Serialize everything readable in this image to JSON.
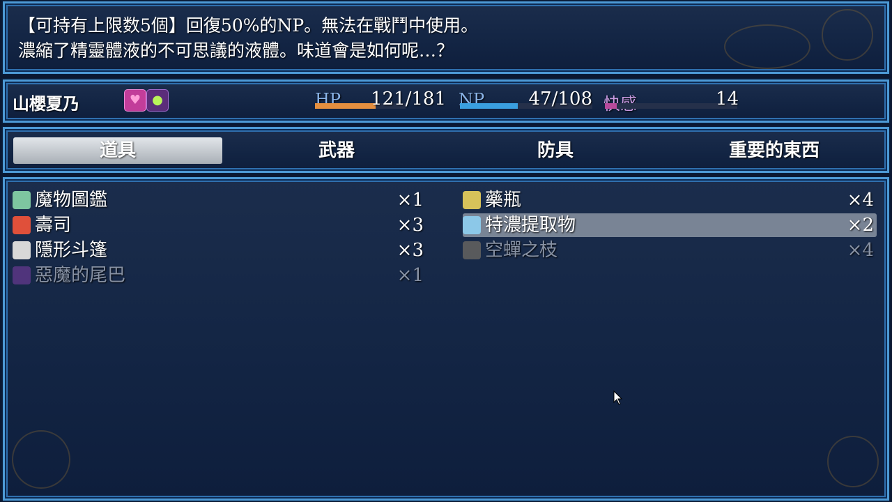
{
  "help": {
    "line1": "【可持有上限数5個】回復50%的NP。無法在戰鬥中使用。",
    "line2": "濃縮了精靈體液的不可思議的液體。味道會是如何呢…？"
  },
  "status": {
    "name": "山櫻夏乃",
    "hp": {
      "label": "HP",
      "value": "121/181",
      "ratio": 0.668,
      "color": "#e58f3f"
    },
    "np": {
      "label": "NP",
      "value": "47/108",
      "ratio": 0.435,
      "color": "#3a9fe0"
    },
    "pleasure": {
      "label": "快感",
      "value": "14",
      "ratio": 0.09,
      "color": "#b84a9c"
    },
    "state_icons": [
      "heart-state-icon",
      "slime-state-icon"
    ]
  },
  "tabs": [
    "道具",
    "武器",
    "防具",
    "重要的東西"
  ],
  "selected_tab": 0,
  "items": [
    {
      "name": "魔物圖鑑",
      "count": "×1",
      "icon": "book-icon",
      "icon_color": "#7ec6a0",
      "enabled": true
    },
    {
      "name": "藥瓶",
      "count": "×4",
      "icon": "vial-icon",
      "icon_color": "#d7c25a",
      "enabled": true
    },
    {
      "name": "壽司",
      "count": "×3",
      "icon": "sushi-icon",
      "icon_color": "#e0503a",
      "enabled": true
    },
    {
      "name": "特濃提取物",
      "count": "×2",
      "icon": "bottle-icon",
      "icon_color": "#8cc8e8",
      "enabled": true,
      "selected": true
    },
    {
      "name": "隱形斗篷",
      "count": "×3",
      "icon": "cloak-icon",
      "icon_color": "#d8d8d8",
      "enabled": true
    },
    {
      "name": "空蟬之枝",
      "count": "×4",
      "icon": "branch-icon",
      "icon_color": "#9a8a70",
      "enabled": false
    },
    {
      "name": "惡魔的尾巴",
      "count": "×1",
      "icon": "demon-tail-icon",
      "icon_color": "#8a3fb0",
      "enabled": false
    }
  ]
}
